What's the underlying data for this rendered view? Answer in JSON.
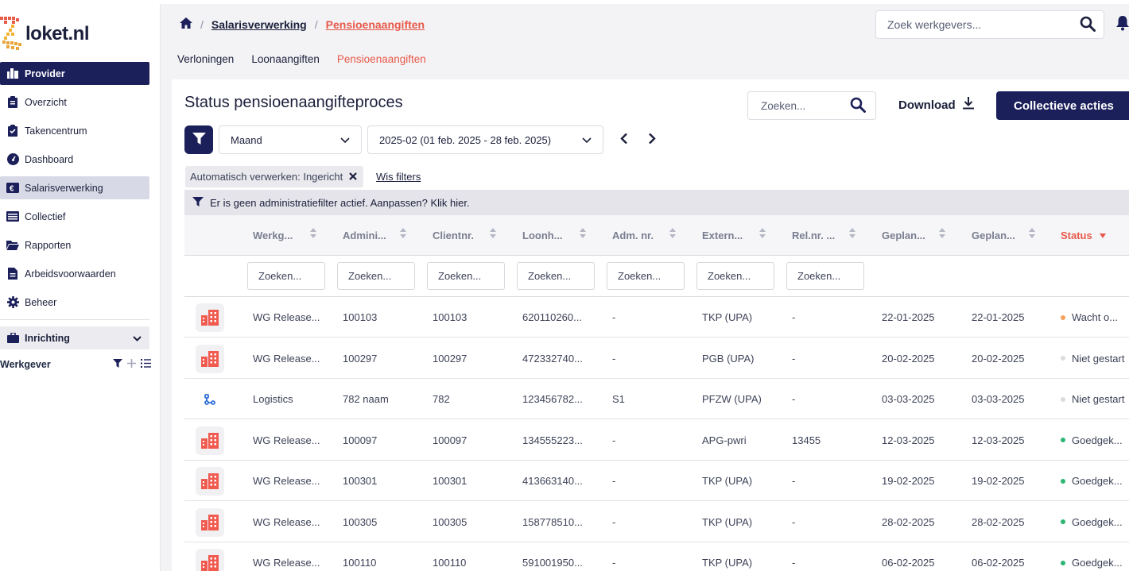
{
  "app": {
    "logo_text": "loket.nl"
  },
  "sidebar": {
    "items": [
      {
        "label": "Provider",
        "icon": "provider-icon"
      },
      {
        "label": "Overzicht",
        "icon": "clipboard-icon"
      },
      {
        "label": "Takencentrum",
        "icon": "task-clipboard-icon"
      },
      {
        "label": "Dashboard",
        "icon": "gauge-icon"
      },
      {
        "label": "Salarisverwerking",
        "icon": "euro-card-icon"
      },
      {
        "label": "Collectief",
        "icon": "list-icon"
      },
      {
        "label": "Rapporten",
        "icon": "folder-open-icon"
      },
      {
        "label": "Arbeidsvoorwaarden",
        "icon": "document-icon"
      },
      {
        "label": "Beheer",
        "icon": "gear-icon"
      }
    ],
    "inrichting": "Inrichting",
    "werkgever": "Werkgever"
  },
  "breadcrumb": {
    "crumb1": "Salarisverwerking",
    "crumb2": "Pensioenaangiften"
  },
  "top_search": {
    "placeholder": "Zoek werkgevers..."
  },
  "subtabs": [
    "Verloningen",
    "Loonaangiften",
    "Pensioenaangiften"
  ],
  "card": {
    "title": "Status pensioenaangifteproces",
    "search_placeholder": "Zoeken...",
    "download_label": "Download",
    "collective_label": "Collectieve acties",
    "period_select": "Maand",
    "range_select": "2025-02 (01 feb. 2025 - 28 feb. 2025)",
    "chip_label": "Automatisch verwerken: Ingericht",
    "clear_filters": "Wis filters",
    "admin_notice": "Er is geen administratiefilter actief. Aanpassen? Klik hier."
  },
  "table": {
    "headers": [
      "Werkg...",
      "Admini...",
      "Clientnr.",
      "Loonh...",
      "Adm. nr.",
      "Extern...",
      "Rel.nr. ...",
      "Geplan...",
      "Geplan...",
      "Status"
    ],
    "filter_placeholder": "Zoeken...",
    "rows": [
      {
        "icon": "building-icon",
        "werkgever": "WG Release...",
        "administratie": "100103",
        "clientnr": "100103",
        "loonheffing": "620110260...",
        "adm_nr": "-",
        "extern": "TKP (UPA)",
        "relnr": "-",
        "gepland1": "22-01-2025",
        "gepland2": "22-01-2025",
        "status": "Wacht o...",
        "status_color": "#f5a25d"
      },
      {
        "icon": "building-icon",
        "werkgever": "WG Release...",
        "administratie": "100297",
        "clientnr": "100297",
        "loonheffing": "472332740...",
        "adm_nr": "-",
        "extern": "PGB (UPA)",
        "relnr": "-",
        "gepland1": "20-02-2025",
        "gepland2": "20-02-2025",
        "status": "Niet gestart",
        "status_color": "#dcdce0"
      },
      {
        "icon": "logistics-icon",
        "werkgever": "Logistics",
        "administratie": "782 naam",
        "clientnr": "782",
        "loonheffing": "123456782...",
        "adm_nr": "S1",
        "extern": "PFZW (UPA)",
        "relnr": "-",
        "gepland1": "03-03-2025",
        "gepland2": "03-03-2025",
        "status": "Niet gestart",
        "status_color": "#dcdce0"
      },
      {
        "icon": "building-icon",
        "werkgever": "WG Release...",
        "administratie": "100097",
        "clientnr": "100097",
        "loonheffing": "134555223...",
        "adm_nr": "-",
        "extern": "APG-pwri",
        "relnr": "13455",
        "gepland1": "12-03-2025",
        "gepland2": "12-03-2025",
        "status": "Goedgek...",
        "status_color": "#2bb673"
      },
      {
        "icon": "building-icon",
        "werkgever": "WG Release...",
        "administratie": "100301",
        "clientnr": "100301",
        "loonheffing": "413663140...",
        "adm_nr": "-",
        "extern": "TKP (UPA)",
        "relnr": "-",
        "gepland1": "19-02-2025",
        "gepland2": "19-02-2025",
        "status": "Goedgek...",
        "status_color": "#2bb673"
      },
      {
        "icon": "building-icon",
        "werkgever": "WG Release...",
        "administratie": "100305",
        "clientnr": "100305",
        "loonheffing": "158778510...",
        "adm_nr": "-",
        "extern": "TKP (UPA)",
        "relnr": "-",
        "gepland1": "28-02-2025",
        "gepland2": "28-02-2025",
        "status": "Goedgek...",
        "status_color": "#2bb673"
      },
      {
        "icon": "building-icon",
        "werkgever": "WG Release...",
        "administratie": "100110",
        "clientnr": "100110",
        "loonheffing": "591001950...",
        "adm_nr": "-",
        "extern": "TKP (UPA)",
        "relnr": "-",
        "gepland1": "06-02-2025",
        "gepland2": "06-02-2025",
        "status": "Goedgek...",
        "status_color": "#2bb673"
      }
    ]
  },
  "colors": {
    "brand": "#1b1f5a",
    "accent": "#e8594a",
    "building_icon": "#f05a4f"
  }
}
